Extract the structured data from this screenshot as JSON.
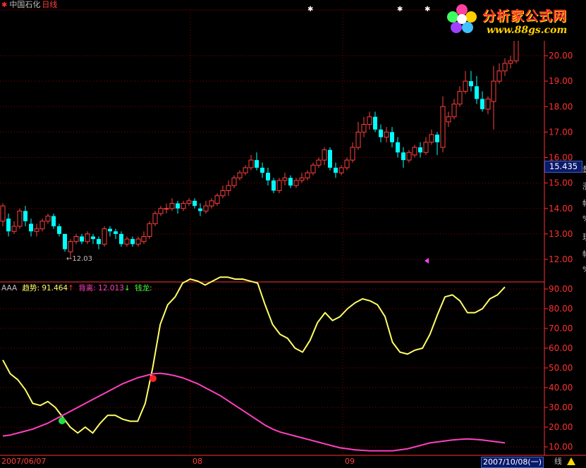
{
  "title": {
    "stock": "中国石化",
    "period": "日线"
  },
  "indicator": {
    "name": "AAA",
    "line1_label": "趋势:",
    "line1_value": "91.464",
    "line1_arrow": "↑",
    "line2_label": "背离:",
    "line2_value": "12.013",
    "line2_arrow": "↓",
    "line3_label": "钱龙:"
  },
  "price_tag": "15.435",
  "low_label": "←12.03",
  "price_axis": [
    "20.00",
    "19.00",
    "18.00",
    "17.00",
    "16.00",
    "15.00",
    "14.00",
    "13.00",
    "12.00"
  ],
  "ind_axis": [
    "90.00",
    "80.00",
    "70.00",
    "60.00",
    "50.00",
    "40.00",
    "30.00",
    "20.00",
    "10.00"
  ],
  "dates": {
    "start": "2007/06/07",
    "month_aug": "08",
    "month_sep": "09",
    "cursor": "2007/10/08(一)"
  },
  "corner": "线",
  "logo": {
    "title": "分析家公式网",
    "url": "www.88gs.com"
  },
  "side_chars": [
    "量",
    "涨",
    "幅",
    "%",
    "现",
    "幅",
    "%"
  ],
  "colors": {
    "up": "#ff4040",
    "down": "#00ffff",
    "trend": "#ffff66",
    "diverge": "#ff40c0",
    "grid": "#8b0000",
    "axis": "#ff3030"
  },
  "chart_data": [
    {
      "type": "candlestick",
      "ylim": [
        11.9,
        20.9
      ],
      "candles": [
        [
          13.5,
          14.1,
          14.2,
          13.3
        ],
        [
          13.6,
          13.1,
          13.8,
          12.9
        ],
        [
          13.1,
          13.3,
          13.5,
          13.0
        ],
        [
          13.3,
          13.9,
          14.0,
          13.2
        ],
        [
          13.9,
          13.5,
          14.1,
          13.3
        ],
        [
          13.4,
          13.1,
          13.6,
          12.9
        ],
        [
          13.1,
          13.2,
          13.4,
          12.9
        ],
        [
          13.2,
          13.5,
          13.6,
          13.1
        ],
        [
          13.5,
          13.7,
          13.8,
          13.4
        ],
        [
          13.7,
          13.3,
          13.8,
          13.2
        ],
        [
          13.3,
          13.0,
          13.4,
          12.9
        ],
        [
          13.0,
          12.4,
          13.0,
          12.3
        ],
        [
          12.3,
          12.7,
          12.8,
          12.03
        ],
        [
          12.7,
          12.9,
          13.0,
          12.6
        ],
        [
          12.9,
          12.7,
          13.0,
          12.6
        ],
        [
          12.7,
          13.0,
          13.1,
          12.6
        ],
        [
          12.9,
          12.8,
          13.0,
          12.6
        ],
        [
          12.8,
          12.6,
          12.9,
          12.4
        ],
        [
          12.6,
          13.2,
          13.3,
          12.5
        ],
        [
          13.2,
          13.1,
          13.3,
          12.9
        ],
        [
          13.1,
          13.0,
          13.2,
          12.8
        ],
        [
          13.0,
          12.6,
          13.1,
          12.5
        ],
        [
          12.6,
          12.8,
          12.9,
          12.5
        ],
        [
          12.8,
          12.6,
          12.9,
          12.5
        ],
        [
          12.6,
          12.8,
          12.9,
          12.5
        ],
        [
          12.7,
          12.9,
          13.1,
          12.6
        ],
        [
          12.9,
          13.4,
          13.5,
          12.8
        ],
        [
          13.4,
          13.8,
          13.9,
          13.3
        ],
        [
          13.8,
          14.0,
          14.1,
          13.7
        ],
        [
          14.0,
          14.0,
          14.2,
          13.8
        ],
        [
          14.0,
          14.2,
          14.4,
          13.9
        ],
        [
          14.2,
          14.0,
          14.3,
          13.8
        ],
        [
          14.0,
          14.2,
          14.3,
          13.9
        ],
        [
          14.2,
          14.3,
          14.4,
          14.1
        ],
        [
          14.3,
          14.1,
          14.4,
          14.0
        ],
        [
          14.0,
          13.9,
          14.2,
          13.7
        ],
        [
          13.9,
          14.1,
          14.3,
          13.8
        ],
        [
          14.1,
          14.3,
          14.4,
          14.0
        ],
        [
          14.2,
          14.5,
          14.6,
          14.1
        ],
        [
          14.5,
          14.7,
          14.9,
          14.4
        ],
        [
          14.7,
          14.9,
          15.1,
          14.5
        ],
        [
          14.9,
          15.2,
          15.3,
          14.8
        ],
        [
          15.2,
          15.4,
          15.5,
          15.1
        ],
        [
          15.4,
          15.6,
          15.7,
          15.3
        ],
        [
          15.6,
          15.9,
          16.1,
          15.5
        ],
        [
          15.9,
          15.6,
          16.2,
          15.5
        ],
        [
          15.6,
          15.4,
          15.8,
          15.2
        ],
        [
          15.4,
          15.1,
          15.6,
          14.9
        ],
        [
          15.1,
          14.7,
          15.2,
          14.6
        ],
        [
          14.7,
          15.1,
          15.2,
          14.6
        ],
        [
          15.1,
          15.2,
          15.4,
          14.9
        ],
        [
          15.2,
          14.9,
          15.3,
          14.8
        ],
        [
          14.9,
          15.1,
          15.2,
          14.8
        ],
        [
          15.1,
          15.2,
          15.4,
          15.0
        ],
        [
          15.2,
          15.4,
          15.5,
          15.1
        ],
        [
          15.4,
          15.7,
          15.8,
          15.3
        ],
        [
          15.7,
          15.9,
          16.0,
          15.6
        ],
        [
          15.9,
          16.3,
          16.4,
          15.7
        ],
        [
          16.3,
          15.6,
          16.4,
          15.5
        ],
        [
          15.6,
          15.4,
          15.8,
          15.2
        ],
        [
          15.4,
          15.6,
          15.7,
          15.3
        ],
        [
          15.6,
          15.9,
          16.0,
          15.5
        ],
        [
          15.9,
          16.4,
          16.6,
          15.8
        ],
        [
          16.4,
          17.0,
          17.4,
          16.3
        ],
        [
          17.0,
          17.3,
          17.6,
          16.8
        ],
        [
          17.3,
          17.6,
          17.8,
          17.1
        ],
        [
          17.6,
          17.1,
          17.8,
          17.0
        ],
        [
          17.1,
          16.8,
          17.3,
          16.6
        ],
        [
          16.8,
          17.0,
          17.2,
          16.6
        ],
        [
          17.0,
          16.6,
          17.2,
          16.4
        ],
        [
          16.6,
          16.2,
          16.8,
          16.0
        ],
        [
          16.2,
          15.9,
          16.4,
          15.6
        ],
        [
          15.9,
          16.2,
          16.3,
          15.8
        ],
        [
          16.1,
          16.4,
          16.5,
          16.0
        ],
        [
          16.4,
          16.2,
          16.6,
          16.0
        ],
        [
          16.2,
          16.6,
          16.8,
          16.1
        ],
        [
          16.6,
          16.9,
          17.1,
          16.5
        ],
        [
          16.9,
          16.6,
          17.0,
          16.1
        ],
        [
          16.4,
          18.0,
          18.4,
          16.2
        ],
        [
          17.4,
          17.6,
          17.8,
          17.2
        ],
        [
          17.6,
          18.1,
          18.3,
          17.5
        ],
        [
          18.1,
          18.6,
          18.8,
          18.0
        ],
        [
          18.6,
          19.0,
          19.4,
          18.5
        ],
        [
          19.0,
          18.8,
          19.4,
          18.6
        ],
        [
          18.8,
          18.3,
          19.2,
          18.1
        ],
        [
          18.3,
          17.9,
          18.6,
          17.8
        ],
        [
          17.9,
          18.3,
          18.4,
          17.7
        ],
        [
          18.2,
          19.0,
          19.6,
          17.1
        ],
        [
          19.0,
          19.4,
          19.7,
          18.9
        ],
        [
          19.4,
          19.7,
          19.9,
          19.2
        ],
        [
          19.7,
          19.8,
          20.0,
          19.5
        ],
        [
          19.8,
          20.6,
          20.9,
          19.7
        ]
      ]
    },
    {
      "type": "line",
      "ylim": [
        5,
        100
      ],
      "series": [
        {
          "name": "趋势",
          "values": [
            54,
            47,
            44,
            39,
            32,
            31,
            33,
            30,
            25,
            20,
            17,
            20,
            17,
            22,
            26,
            26,
            24,
            23,
            23,
            32,
            50,
            72,
            82,
            86,
            93,
            95,
            94,
            92,
            94,
            96,
            96,
            95,
            95,
            94,
            93,
            82,
            72,
            67,
            65,
            60,
            58,
            64,
            73,
            78,
            74,
            76,
            80,
            83,
            85,
            84,
            82,
            76,
            63,
            58,
            57,
            59,
            60,
            67,
            77,
            86,
            87,
            84,
            78,
            78,
            80,
            85,
            87,
            91
          ]
        },
        {
          "name": "背离",
          "values": [
            15.5,
            16,
            17,
            18,
            19,
            20.5,
            22,
            24,
            26,
            28,
            30,
            32,
            34,
            36,
            38,
            40,
            42,
            43.5,
            45,
            46,
            47,
            47.3,
            46.8,
            46,
            45,
            43.5,
            42,
            40,
            38,
            36,
            33.5,
            31,
            28.5,
            26,
            23.5,
            21,
            19,
            17.5,
            16.5,
            15.5,
            14.5,
            13.5,
            12.5,
            11.5,
            10.5,
            9.5,
            9,
            8.5,
            8.2,
            8,
            8,
            8,
            8,
            8.5,
            9,
            10,
            11,
            12,
            12.5,
            13,
            13.5,
            13.8,
            14,
            13.8,
            13.5,
            13,
            12.5,
            12.013
          ]
        }
      ]
    }
  ]
}
